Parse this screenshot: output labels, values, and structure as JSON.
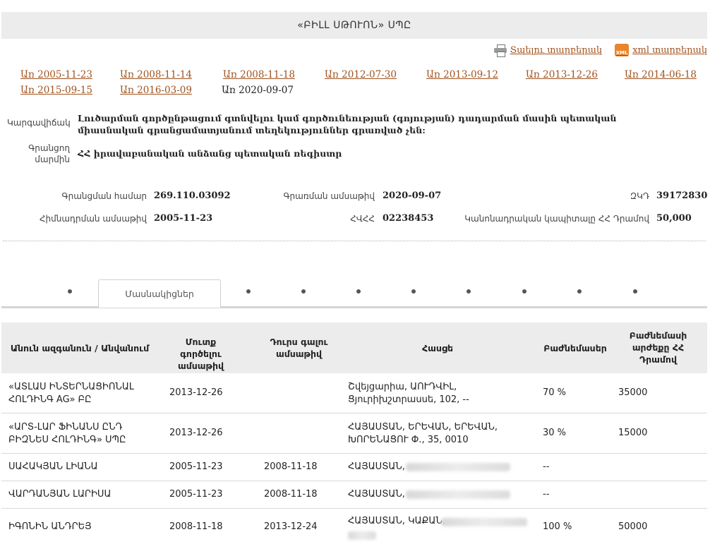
{
  "header": {
    "title": "«ԲԻԼԼ ՍԹՈՒՈՆ» ՍՊԸ"
  },
  "export": {
    "print_label": "Տպելու տարբերակ",
    "xml_label": "xml տարբերակ",
    "xml_icon_text": "XML"
  },
  "dates_row1": [
    "Առ 2005-11-23",
    "Առ 2008-11-14",
    "Առ 2008-11-18",
    "Առ 2012-07-30",
    "Առ 2013-09-12",
    "Առ 2013-12-26",
    "Առ 2014-06-18"
  ],
  "dates_row2": [
    "Առ 2015-09-15",
    "Առ 2016-03-09"
  ],
  "date_current": "Առ 2020-09-07",
  "status": {
    "label": "Կարգավիճակ",
    "value": "Լուծարման գործընթացում գտնվելու կամ գործունեության (գոյության) դադարման մասին պետական միասնական գրանցամատյանում տեղեկություններ գրառված չեն:"
  },
  "registrar": {
    "label": "Գրանցող մարմին",
    "value": "ՀՀ իրավաբանական անձանց պետական ռեգիստր"
  },
  "details": {
    "reg_number_label": "Գրանցման համար",
    "reg_number": "269.110.03092",
    "reg_date_label": "Գրառման ամսաթիվ",
    "reg_date": "2020-09-07",
    "zkd_label": "ԶԿԴ",
    "zkd": "39172830",
    "founding_date_label": "Հիմնադրման ամսաթիվ",
    "founding_date": "2005-11-23",
    "tin_label": "ՀՎՀՀ",
    "tin": "02238453",
    "capital_label": "Կանոնադրական կապիտալը ՀՀ Դրամով",
    "capital": "50,000"
  },
  "tabs": {
    "active_label": "Մասնակիցներ",
    "inactive_count": 10
  },
  "table": {
    "headers": [
      "Անուն ազգանուն / Անվանում",
      "Մուտք գործելու ամսաթիվ",
      "Դուրս գալու ամսաթիվ",
      "Հասցե",
      "Բաժնեմասեր",
      "Բաժնեմասի արժեքը ՀՀ Դրամով"
    ],
    "rows": [
      {
        "name": "«ԱՏԼԱՍ ԻՆՏԵՐՆԱՑԻՈՆԱԼ ՀՈԼԴԻՆԳ AG» ԲԸ",
        "in": "2013-12-26",
        "out": "",
        "address": "Շվեյցարիա, ԱՈՒԴՎԻԼ, Ցյուրիխշտրասսե, 102, --",
        "share": "70 %",
        "value": "35000"
      },
      {
        "name": "«ԱՐՏ-ԼԱՐ ՖԻՆԱՆՍ ԸՆԴ ԲԻԶՆԵՍ ՀՈԼԴԻՆԳ» ՍՊԸ",
        "in": "2013-12-26",
        "out": "",
        "address": "ՀԱՅԱՍՏԱՆ, ԵՐԵՎԱՆ, ԵՐԵՎԱՆ, ԽՈՐԵՆԱՑՈՒ Փ., 35, 0010",
        "share": "30 %",
        "value": "15000"
      },
      {
        "name": "ՍԱՀԱԿՅԱՆ ԼԻԱՆԱ",
        "in": "2005-11-23",
        "out": "2008-11-18",
        "address": "ՀԱՅԱՍՏԱՆ,",
        "share": "--",
        "value": ""
      },
      {
        "name": "ՎԱՐԴԱՆՅԱՆ ԼԱՐԻՍԱ",
        "in": "2005-11-23",
        "out": "2008-11-18",
        "address": "ՀԱՅԱՍՏԱՆ,",
        "share": "--",
        "value": ""
      },
      {
        "name": "ԻԳՈՆԻՆ ԱՆԴՐԵՅ",
        "in": "2008-11-18",
        "out": "2013-12-24",
        "address": "ՀԱՅԱՍՏԱՆ, ԿԱՔԱՆ,",
        "share": "100 %",
        "value": "50000"
      }
    ]
  }
}
